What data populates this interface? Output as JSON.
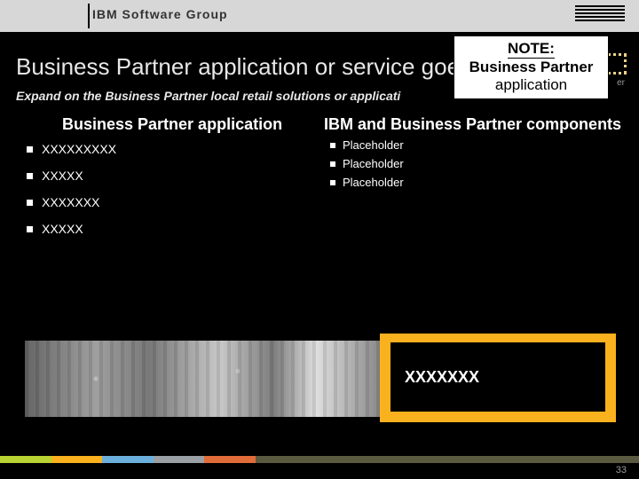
{
  "header": {
    "group_label": "IBM Software Group"
  },
  "note": {
    "line1": "NOTE:",
    "line2": "Business Partner",
    "line3": "application",
    "behind_fragment": "er"
  },
  "title": "Business Partner application or service goe",
  "subtitle": "Expand on the Business Partner local retail solutions or applicati",
  "columns": {
    "left": {
      "heading": "Business Partner application",
      "items": [
        "XXXXXXXXX",
        "XXXXX",
        "XXXXXXX",
        "XXXXX"
      ]
    },
    "right": {
      "heading": "IBM and Business Partner components",
      "items": [
        "Placeholder",
        "Placeholder",
        "Placeholder"
      ]
    }
  },
  "orange_label": "XXXXXXX",
  "page_number": "33",
  "footer_colors": [
    "#b9d332",
    "#f9b11e",
    "#6bb0dd",
    "#9aa0a3",
    "#e06c3a",
    "#5a5a40"
  ]
}
